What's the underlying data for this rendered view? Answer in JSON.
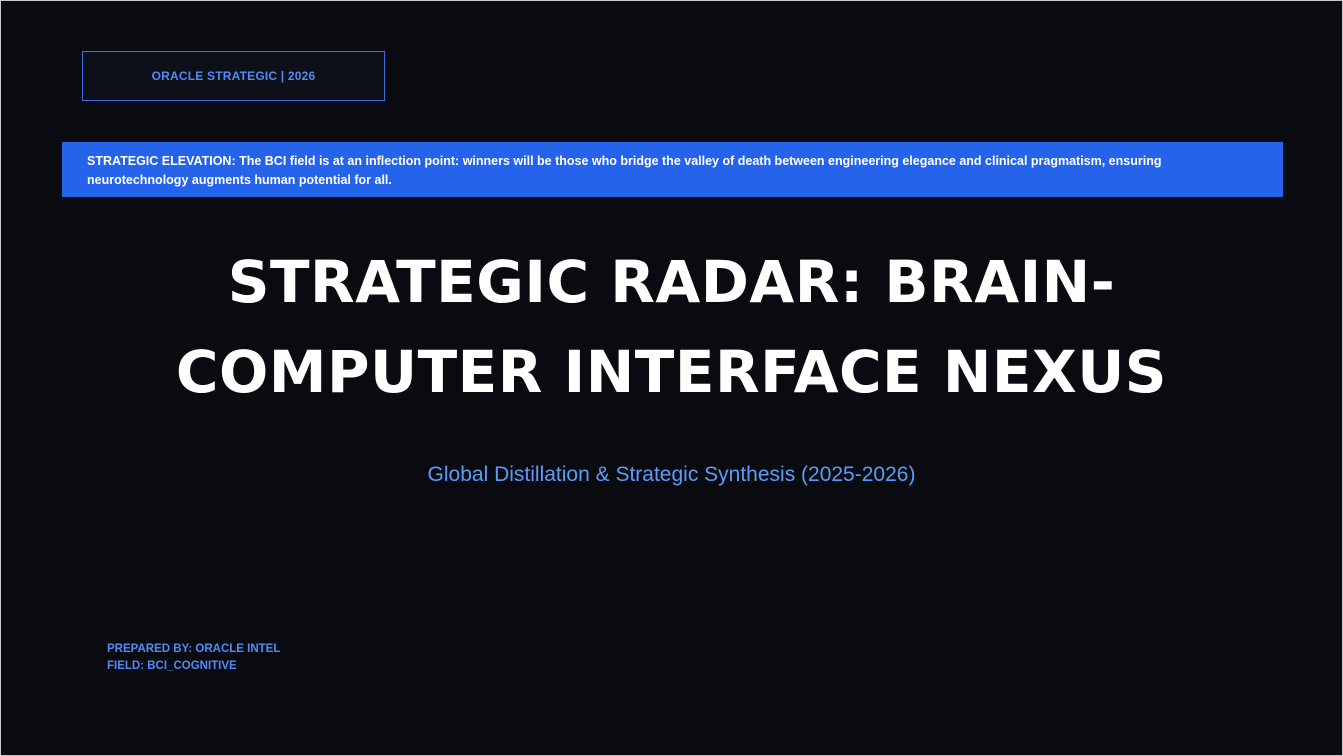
{
  "brand": {
    "label": "ORACLE STRATEGIC | 2026"
  },
  "banner": {
    "text": "STRATEGIC ELEVATION: The BCI field is at an inflection point: winners will be those who bridge the valley of death between engineering elegance and clinical pragmatism, ensuring neurotechnology augments human potential for all."
  },
  "title": {
    "line1": "STRATEGIC RADAR: BRAIN-",
    "line2": "COMPUTER INTERFACE NEXUS"
  },
  "subtitle": "Global Distillation & Strategic Synthesis (2025-2026)",
  "footer": {
    "prepared_by": "PREPARED BY: ORACLE INTEL",
    "field": "FIELD: BCI_COGNITIVE"
  },
  "colors": {
    "background": "#0a0b10",
    "accent": "#2563eb",
    "accent_text": "#4f8cf7",
    "subtitle": "#5b9cf8",
    "title": "#ffffff"
  }
}
